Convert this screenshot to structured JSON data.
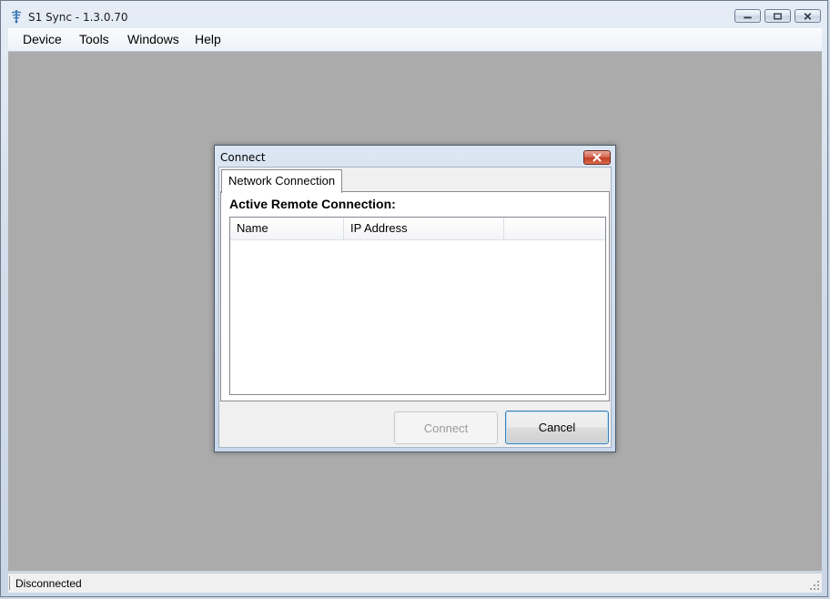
{
  "window": {
    "title": "S1 Sync - 1.3.0.70",
    "icon": "app-logo-icon",
    "controls": [
      "minimize-icon",
      "maximize-icon",
      "close-icon"
    ]
  },
  "menu": {
    "items": [
      "Device",
      "Tools",
      "Windows",
      "Help"
    ]
  },
  "dialog": {
    "title": "Connect",
    "tab": "Network Connection",
    "heading": "Active Remote Connection:",
    "columns": [
      "Name",
      "IP Address",
      ""
    ],
    "rows": [],
    "connect_label": "Connect",
    "connect_enabled": false,
    "cancel_label": "Cancel"
  },
  "status": {
    "text": "Disconnected"
  },
  "colors": {
    "workspace": "#ababab",
    "dialog_close": "#c23d22",
    "default_button_border": "#3c7fb1"
  }
}
